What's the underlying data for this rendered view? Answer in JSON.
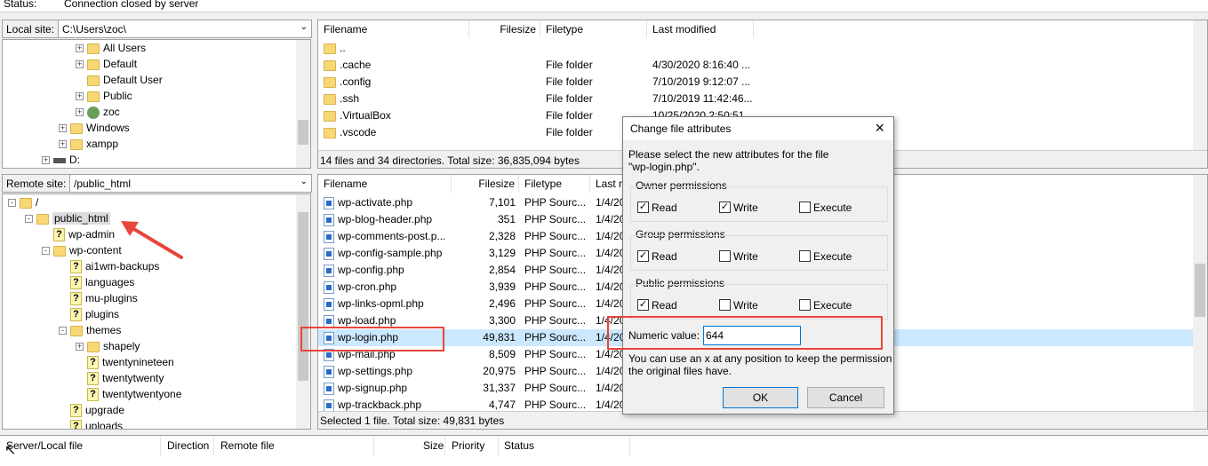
{
  "status": {
    "label": "Status:",
    "value": "Connection closed by server"
  },
  "local_site": {
    "label": "Local site:",
    "path": "C:\\Users\\zoc\\"
  },
  "local_tree": [
    {
      "label": "All Users",
      "indent": 4,
      "expander": "+",
      "icon": "folder"
    },
    {
      "label": "Default",
      "indent": 4,
      "expander": "+",
      "icon": "folder"
    },
    {
      "label": "Default User",
      "indent": 4,
      "expander": "",
      "icon": "folder"
    },
    {
      "label": "Public",
      "indent": 4,
      "expander": "+",
      "icon": "folder"
    },
    {
      "label": "zoc",
      "indent": 4,
      "expander": "+",
      "icon": "user"
    },
    {
      "label": "Windows",
      "indent": 3,
      "expander": "+",
      "icon": "folder"
    },
    {
      "label": "xampp",
      "indent": 3,
      "expander": "+",
      "icon": "folder"
    },
    {
      "label": "D:",
      "indent": 2,
      "expander": "+",
      "icon": "drive"
    }
  ],
  "local_files": {
    "headers": {
      "filename": "Filename",
      "filesize": "Filesize",
      "filetype": "Filetype",
      "modified": "Last modified"
    },
    "rows": [
      {
        "name": "..",
        "size": "",
        "type": "",
        "modified": ""
      },
      {
        "name": ".cache",
        "size": "",
        "type": "File folder",
        "modified": "4/30/2020 8:16:40 ..."
      },
      {
        "name": ".config",
        "size": "",
        "type": "File folder",
        "modified": "7/10/2019 9:12:07 ..."
      },
      {
        "name": ".ssh",
        "size": "",
        "type": "File folder",
        "modified": "7/10/2019 11:42:46..."
      },
      {
        "name": ".VirtualBox",
        "size": "",
        "type": "File folder",
        "modified": "10/25/2020 2:50:51..."
      },
      {
        "name": ".vscode",
        "size": "",
        "type": "File folder",
        "modified": ""
      }
    ],
    "summary": "14 files and 34 directories. Total size: 36,835,094 bytes"
  },
  "remote_site": {
    "label": "Remote site:",
    "path": "/public_html"
  },
  "remote_tree": [
    {
      "label": "/",
      "indent": 0,
      "expander": "-",
      "icon": "folder"
    },
    {
      "label": "public_html",
      "indent": 1,
      "expander": "-",
      "icon": "folder"
    },
    {
      "label": "wp-admin",
      "indent": 2,
      "expander": "",
      "icon": "q"
    },
    {
      "label": "wp-content",
      "indent": 2,
      "expander": "-",
      "icon": "folder"
    },
    {
      "label": "ai1wm-backups",
      "indent": 3,
      "expander": "",
      "icon": "q"
    },
    {
      "label": "languages",
      "indent": 3,
      "expander": "",
      "icon": "q"
    },
    {
      "label": "mu-plugins",
      "indent": 3,
      "expander": "",
      "icon": "q"
    },
    {
      "label": "plugins",
      "indent": 3,
      "expander": "",
      "icon": "q"
    },
    {
      "label": "themes",
      "indent": 3,
      "expander": "-",
      "icon": "folder"
    },
    {
      "label": "shapely",
      "indent": 4,
      "expander": "+",
      "icon": "folder"
    },
    {
      "label": "twentynineteen",
      "indent": 4,
      "expander": "",
      "icon": "q"
    },
    {
      "label": "twentytwenty",
      "indent": 4,
      "expander": "",
      "icon": "q"
    },
    {
      "label": "twentytwentyone",
      "indent": 4,
      "expander": "",
      "icon": "q"
    },
    {
      "label": "upgrade",
      "indent": 3,
      "expander": "",
      "icon": "q"
    },
    {
      "label": "uploads",
      "indent": 3,
      "expander": "",
      "icon": "q"
    }
  ],
  "remote_files": {
    "headers": {
      "filename": "Filename",
      "filesize": "Filesize",
      "filetype": "Filetype",
      "modified": "Last m"
    },
    "rows": [
      {
        "name": "wp-activate.php",
        "size": "7,101",
        "type": "PHP Sourc...",
        "modified": "1/4/20"
      },
      {
        "name": "wp-blog-header.php",
        "size": "351",
        "type": "PHP Sourc...",
        "modified": "1/4/20"
      },
      {
        "name": "wp-comments-post.p...",
        "size": "2,328",
        "type": "PHP Sourc...",
        "modified": "1/4/20"
      },
      {
        "name": "wp-config-sample.php",
        "size": "3,129",
        "type": "PHP Sourc...",
        "modified": "1/4/20"
      },
      {
        "name": "wp-config.php",
        "size": "2,854",
        "type": "PHP Sourc...",
        "modified": "1/4/20"
      },
      {
        "name": "wp-cron.php",
        "size": "3,939",
        "type": "PHP Sourc...",
        "modified": "1/4/20"
      },
      {
        "name": "wp-links-opml.php",
        "size": "2,496",
        "type": "PHP Sourc...",
        "modified": "1/4/20"
      },
      {
        "name": "wp-load.php",
        "size": "3,300",
        "type": "PHP Sourc...",
        "modified": "1/4/20"
      },
      {
        "name": "wp-login.php",
        "size": "49,831",
        "type": "PHP Sourc...",
        "modified": "1/4/20"
      },
      {
        "name": "wp-mail.php",
        "size": "8,509",
        "type": "PHP Sourc...",
        "modified": "1/4/20"
      },
      {
        "name": "wp-settings.php",
        "size": "20,975",
        "type": "PHP Sourc...",
        "modified": "1/4/20"
      },
      {
        "name": "wp-signup.php",
        "size": "31,337",
        "type": "PHP Sourc...",
        "modified": "1/4/20"
      },
      {
        "name": "wp-trackback.php",
        "size": "4,747",
        "type": "PHP Sourc...",
        "modified": "1/4/20"
      }
    ],
    "summary": "Selected 1 file. Total size: 49,831 bytes"
  },
  "queue": {
    "server_local": "Server/Local file",
    "direction": "Direction",
    "remote": "Remote file",
    "size": "Size",
    "priority": "Priority",
    "status": "Status"
  },
  "dialog": {
    "title": "Change file attributes",
    "intro_line1": "Please select the new attributes for the file",
    "intro_line2": "\"wp-login.php\".",
    "groups": [
      {
        "title": "Owner permissions",
        "read": true,
        "write": true,
        "execute": false
      },
      {
        "title": "Group permissions",
        "read": true,
        "write": false,
        "execute": false
      },
      {
        "title": "Public permissions",
        "read": true,
        "write": false,
        "execute": false
      }
    ],
    "labels": {
      "read": "Read",
      "write": "Write",
      "execute": "Execute"
    },
    "numeric_label": "Numeric value:",
    "numeric_value": "644",
    "hint_line1": "You can use an x at any position to keep the permission",
    "hint_line2": "the original files have.",
    "ok": "OK",
    "cancel": "Cancel"
  },
  "colors": {
    "highlight": "#e8453c",
    "selection": "#cce8ff"
  }
}
